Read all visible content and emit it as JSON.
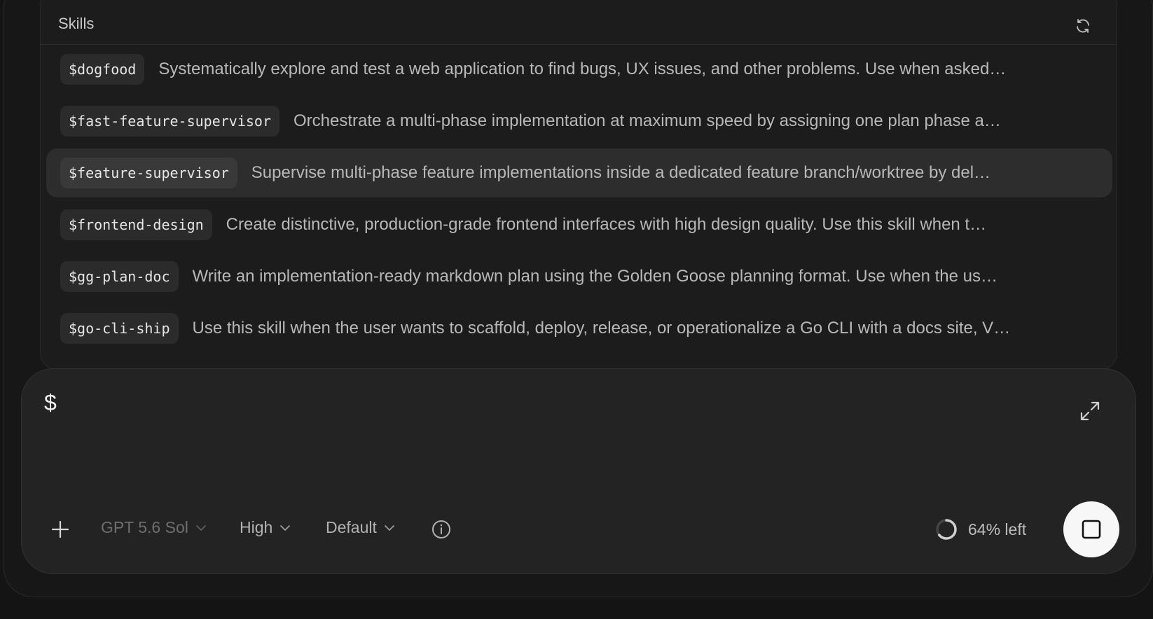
{
  "skills": {
    "title": "Skills",
    "refresh_icon": "refresh-icon",
    "items": [
      {
        "tag": "$dogfood",
        "description": "Systematically explore and test a web application to find bugs, UX issues, and other problems. Use when asked…",
        "selected": false
      },
      {
        "tag": "$fast-feature-supervisor",
        "description": "Orchestrate a multi-phase implementation at maximum speed by assigning one plan phase a…",
        "selected": false
      },
      {
        "tag": "$feature-supervisor",
        "description": "Supervise multi-phase feature implementations inside a dedicated feature branch/worktree by del…",
        "selected": true
      },
      {
        "tag": "$frontend-design",
        "description": "Create distinctive, production-grade frontend interfaces with high design quality. Use this skill when t…",
        "selected": false
      },
      {
        "tag": "$gg-plan-doc",
        "description": "Write an implementation-ready markdown plan using the Golden Goose planning format. Use when the us…",
        "selected": false
      },
      {
        "tag": "$go-cli-ship",
        "description": "Use this skill when the user wants to scaffold, deploy, release, or operationalize a Go CLI with a docs site, V…",
        "selected": false
      }
    ]
  },
  "composer": {
    "input_value": "$",
    "expand_icon": "expand-icon",
    "add_icon": "plus-icon",
    "model_label": "GPT 5.6 Sol",
    "effort_label": "High",
    "mode_label": "Default",
    "info_icon": "info-icon",
    "context_remaining_percent": 64,
    "context_label": "64% left",
    "stop_icon": "stop-icon"
  },
  "colors": {
    "background": "#141414",
    "panel": "#1c1c1c",
    "selected_row": "#2d2d2d",
    "composer": "#232323",
    "stop_button": "#f7f7f7"
  }
}
